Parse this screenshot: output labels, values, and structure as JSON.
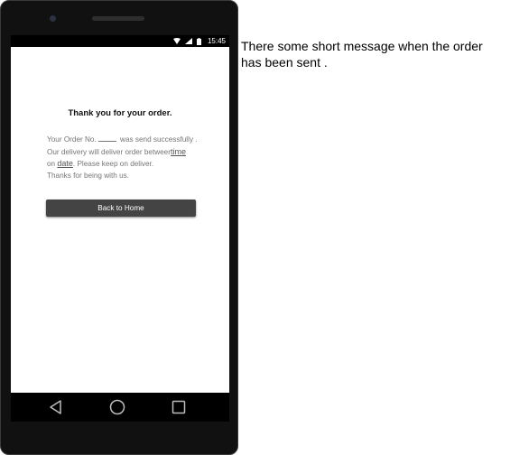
{
  "status_bar": {
    "time": "15:45",
    "icons": [
      "wifi-icon",
      "signal-icon",
      "battery-icon"
    ]
  },
  "screen": {
    "title": "Thank you for your order.",
    "message": {
      "line1_a": "Your Order No.",
      "line1_b": " was send successfully .",
      "line2_a": "Our delivery will deliver order betweer",
      "line2_time": "time",
      "line3_a": "on ",
      "line3_date": "date",
      "line3_b": ".  Please keep on deliver.",
      "line4": "Thanks for being with us."
    },
    "back_button_label": "Back to Home"
  },
  "nav_bar": {
    "icons": [
      "back-triangle-icon",
      "home-circle-icon",
      "recents-square-icon"
    ]
  },
  "annotation": {
    "text": "There some short message when the order has been sent ."
  }
}
